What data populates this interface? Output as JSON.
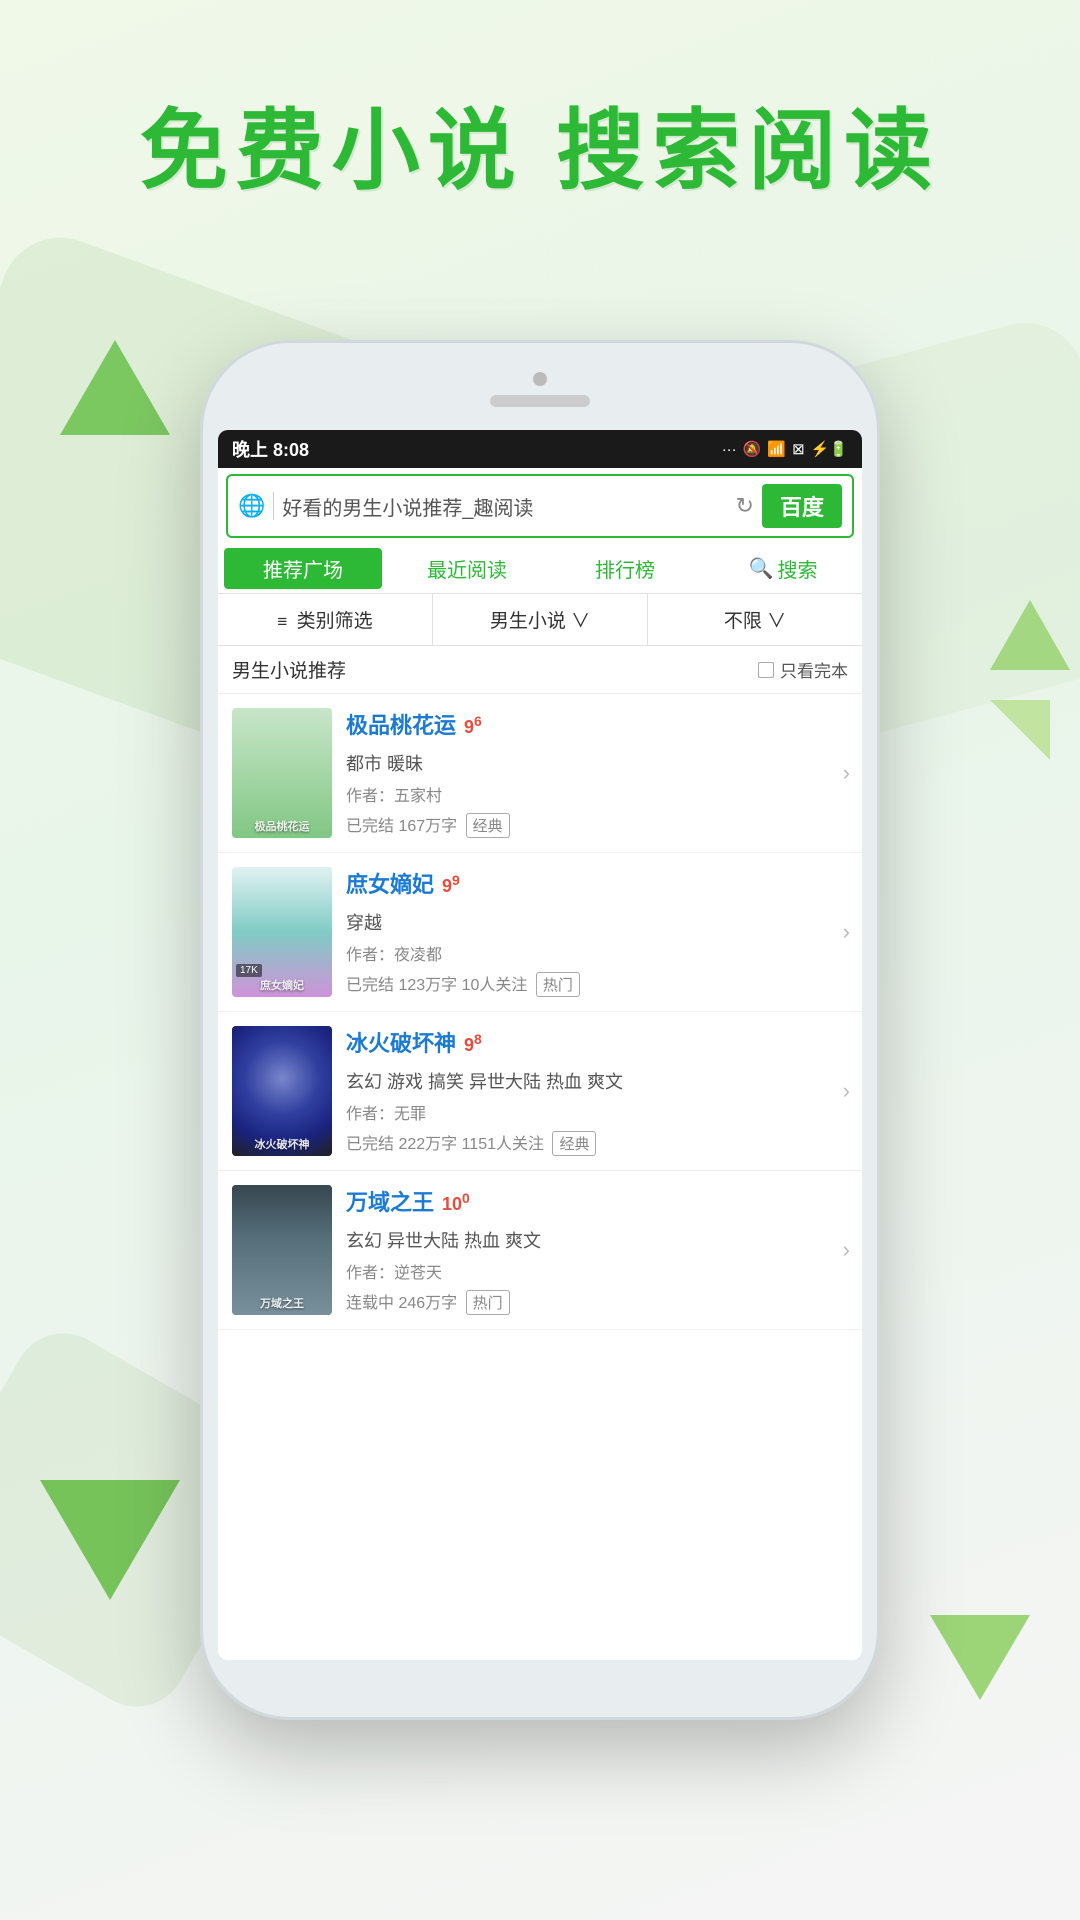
{
  "app": {
    "header_title": "免费小说  搜索阅读"
  },
  "status_bar": {
    "time": "晚上 8:08",
    "signal": "···",
    "mute": "🔕",
    "wifi": "WiFi",
    "sim": "⊠",
    "battery": "⚡🔋"
  },
  "search": {
    "placeholder": "好看的男生小说推荐_趣阅读",
    "refresh_icon": "refresh-icon",
    "baidu_label": "百度",
    "globe_icon": "globe-icon"
  },
  "nav": {
    "tabs": [
      {
        "key": "recommend",
        "label": "推荐广场",
        "active": true
      },
      {
        "key": "recent",
        "label": "最近阅读",
        "active": false
      },
      {
        "key": "ranking",
        "label": "排行榜",
        "active": false
      },
      {
        "key": "search",
        "label": "搜索",
        "active": false,
        "has_icon": true
      }
    ]
  },
  "filter": {
    "items": [
      {
        "key": "category",
        "label": "类别筛选",
        "icon": "≡"
      },
      {
        "key": "gender",
        "label": "男生小说",
        "suffix": "∨"
      },
      {
        "key": "limit",
        "label": "不限",
        "suffix": "∨"
      }
    ]
  },
  "section": {
    "title": "男生小说推荐",
    "filter_label": "只看完本"
  },
  "books": [
    {
      "id": 1,
      "title": "极品桃花运",
      "rating_main": "9",
      "rating_decimal": "6",
      "genre": "都市 暖昧",
      "author": "作者：五家村",
      "completion": "已完结 167万字",
      "tag": "经典",
      "cover_style": "cover-1",
      "cover_label": "极品\n桃花运"
    },
    {
      "id": 2,
      "title": "庶女嫡妃",
      "rating_main": "9",
      "rating_decimal": "9",
      "genre": "穿越",
      "author": "作者：夜凌都",
      "completion": "已完结 123万字 10人关注",
      "tag": "热门",
      "cover_style": "cover-2",
      "cover_label": "庶女嫡妃",
      "cover_badge": "17K"
    },
    {
      "id": 3,
      "title": "冰火破坏神",
      "rating_main": "9",
      "rating_decimal": "8",
      "genre": "玄幻 游戏 搞笑 异世大陆 热血 爽文",
      "author": "作者：无罪",
      "completion": "已完结 222万字 1151人关注",
      "tag": "经典",
      "cover_style": "cover-3",
      "cover_label": "冰火破坏神"
    },
    {
      "id": 4,
      "title": "万域之王",
      "rating_main": "10",
      "rating_decimal": "0",
      "genre": "玄幻 异世大陆 热血 爽文",
      "author": "作者：逆苍天",
      "completion": "连载中 246万字",
      "tag": "热门",
      "cover_style": "cover-4",
      "cover_label": "万域之王"
    }
  ],
  "colors": {
    "green": "#2db936",
    "red": "#e74c3c",
    "blue": "#1a7ad4"
  }
}
